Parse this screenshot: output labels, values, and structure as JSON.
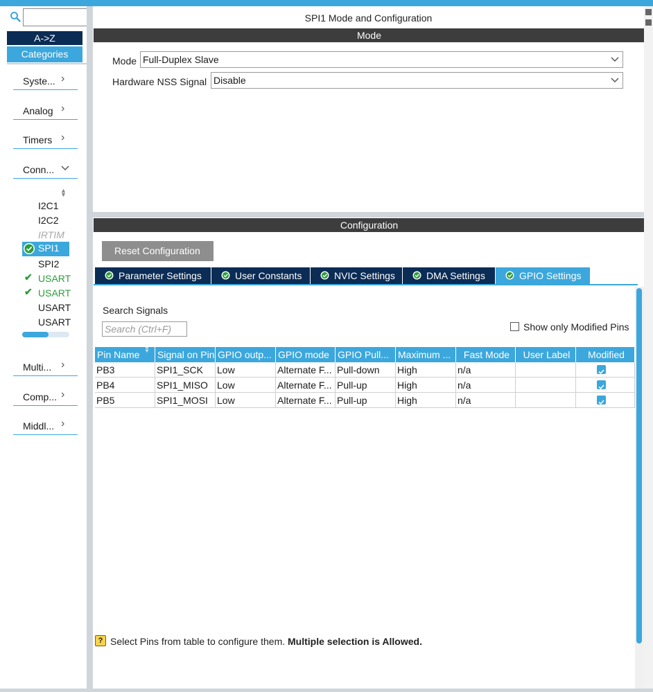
{
  "colors": {
    "accent": "#3ca7dc",
    "navy": "#0b2c55",
    "header_dark": "#3d3d3d",
    "success": "#2a9d3a"
  },
  "left": {
    "az_label": "A->Z",
    "categories_label": "Categories",
    "categories": [
      {
        "label": "Syste...",
        "chevron": ">"
      },
      {
        "label": "Analog",
        "chevron": ">"
      },
      {
        "label": "Timers",
        "chevron": ">"
      },
      {
        "label": "Conn...",
        "chevron": "v"
      },
      {
        "label": "Multi...",
        "chevron": ">"
      },
      {
        "label": "Comp...",
        "chevron": ">"
      },
      {
        "label": "Middl...",
        "chevron": ">"
      }
    ],
    "connectivity_items": [
      {
        "label": "I2C1"
      },
      {
        "label": "I2C2"
      },
      {
        "label": "IRTIM"
      },
      {
        "label": "SPI1"
      },
      {
        "label": "SPI2"
      },
      {
        "label": "USART"
      },
      {
        "label": "USART"
      },
      {
        "label": "USART"
      },
      {
        "label": "USART"
      }
    ],
    "scroll_position": 0.55
  },
  "main": {
    "title": "SPI1 Mode and Configuration",
    "mode_section": "Mode",
    "mode_label": "Mode",
    "mode_value": "Full-Duplex Slave",
    "nss_label": "Hardware NSS Signal",
    "nss_value": "Disable",
    "config_section": "Configuration",
    "reset_button": "Reset Configuration",
    "tabs": [
      {
        "label": "Parameter Settings"
      },
      {
        "label": "User Constants"
      },
      {
        "label": "NVIC Settings"
      },
      {
        "label": "DMA Settings"
      },
      {
        "label": "GPIO Settings"
      }
    ],
    "search_signals_label": "Search Signals",
    "search_placeholder": "Search (Ctrl+F)",
    "show_modified_label": "Show only Modified Pins",
    "table": {
      "headers": [
        "Pin Name",
        "Signal on Pin",
        "GPIO outp...",
        "GPIO mode",
        "GPIO Pull...",
        "Maximum ...",
        "Fast Mode",
        "User Label",
        "Modified"
      ],
      "rows": [
        [
          "PB3",
          "SPI1_SCK",
          "Low",
          "Alternate F...",
          "Pull-down",
          "High",
          "n/a",
          ""
        ],
        [
          "PB4",
          "SPI1_MISO",
          "Low",
          "Alternate F...",
          "Pull-up",
          "High",
          "n/a",
          ""
        ],
        [
          "PB5",
          "SPI1_MOSI",
          "Low",
          "Alternate F...",
          "Pull-up",
          "High",
          "n/a",
          ""
        ]
      ]
    },
    "hint_text": "Select Pins from table to configure them.",
    "hint_bold": "Multiple selection is Allowed."
  }
}
